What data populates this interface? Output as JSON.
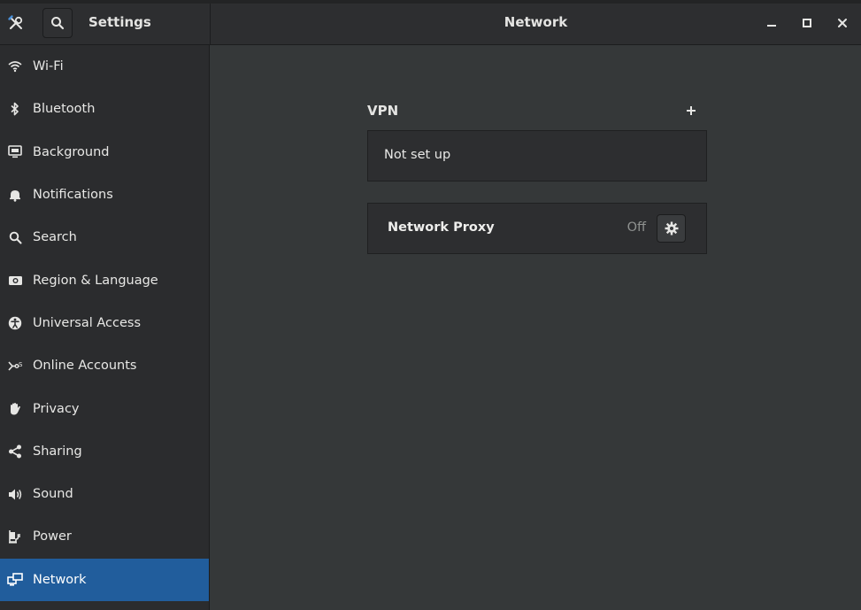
{
  "header": {
    "app_title": "Settings",
    "panel_title": "Network"
  },
  "sidebar": {
    "items": [
      {
        "label": "Wi-Fi",
        "icon": "wifi-icon"
      },
      {
        "label": "Bluetooth",
        "icon": "bluetooth-icon"
      },
      {
        "label": "Background",
        "icon": "background-icon"
      },
      {
        "label": "Notifications",
        "icon": "bell-icon"
      },
      {
        "label": "Search",
        "icon": "search-icon"
      },
      {
        "label": "Region & Language",
        "icon": "camera-icon"
      },
      {
        "label": "Universal Access",
        "icon": "accessibility-icon"
      },
      {
        "label": "Online Accounts",
        "icon": "online-accounts-icon"
      },
      {
        "label": "Privacy",
        "icon": "hand-icon"
      },
      {
        "label": "Sharing",
        "icon": "share-icon"
      },
      {
        "label": "Sound",
        "icon": "speaker-icon"
      },
      {
        "label": "Power",
        "icon": "power-icon"
      },
      {
        "label": "Network",
        "icon": "network-icon",
        "active": true
      }
    ]
  },
  "vpn": {
    "title": "VPN",
    "status": "Not set up"
  },
  "proxy": {
    "label": "Network Proxy",
    "status": "Off"
  },
  "colors": {
    "accent": "#215d9c",
    "sidebar_bg": "#2b2c2e",
    "main_bg": "#353839"
  }
}
